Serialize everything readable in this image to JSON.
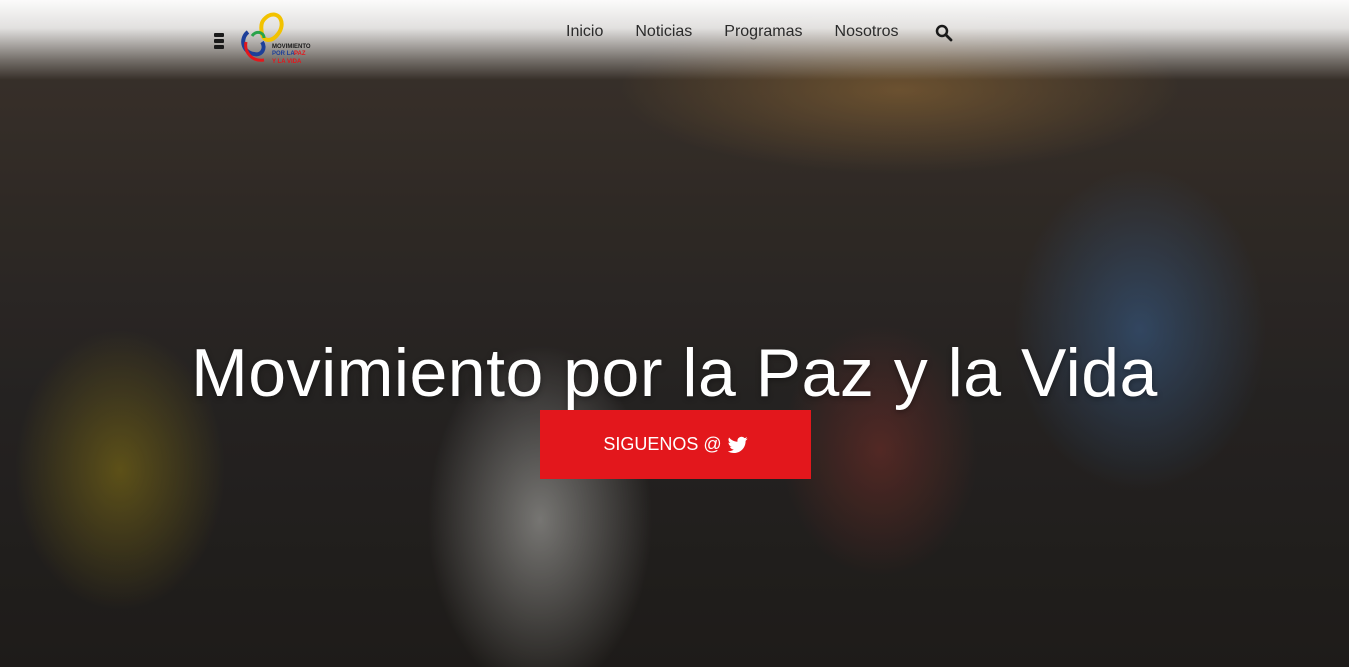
{
  "nav": {
    "links": [
      {
        "label": "Inicio"
      },
      {
        "label": "Noticias"
      },
      {
        "label": "Programas"
      },
      {
        "label": "Nosotros"
      }
    ],
    "search_icon": "search-icon",
    "menu_icon": "hamburger-menu-icon"
  },
  "logo": {
    "line1": "MOVIMIENTO",
    "line2": "POR LA",
    "line3": "PAZ",
    "line4": "Y LA VIDA"
  },
  "hero": {
    "title": "Movimiento por la Paz y la Vida",
    "cta_label": "SIGUENOS @",
    "cta_icon": "twitter-icon"
  },
  "colors": {
    "accent": "#e3171c",
    "nav_text": "#2b2b2b",
    "title_text": "#ffffff"
  }
}
